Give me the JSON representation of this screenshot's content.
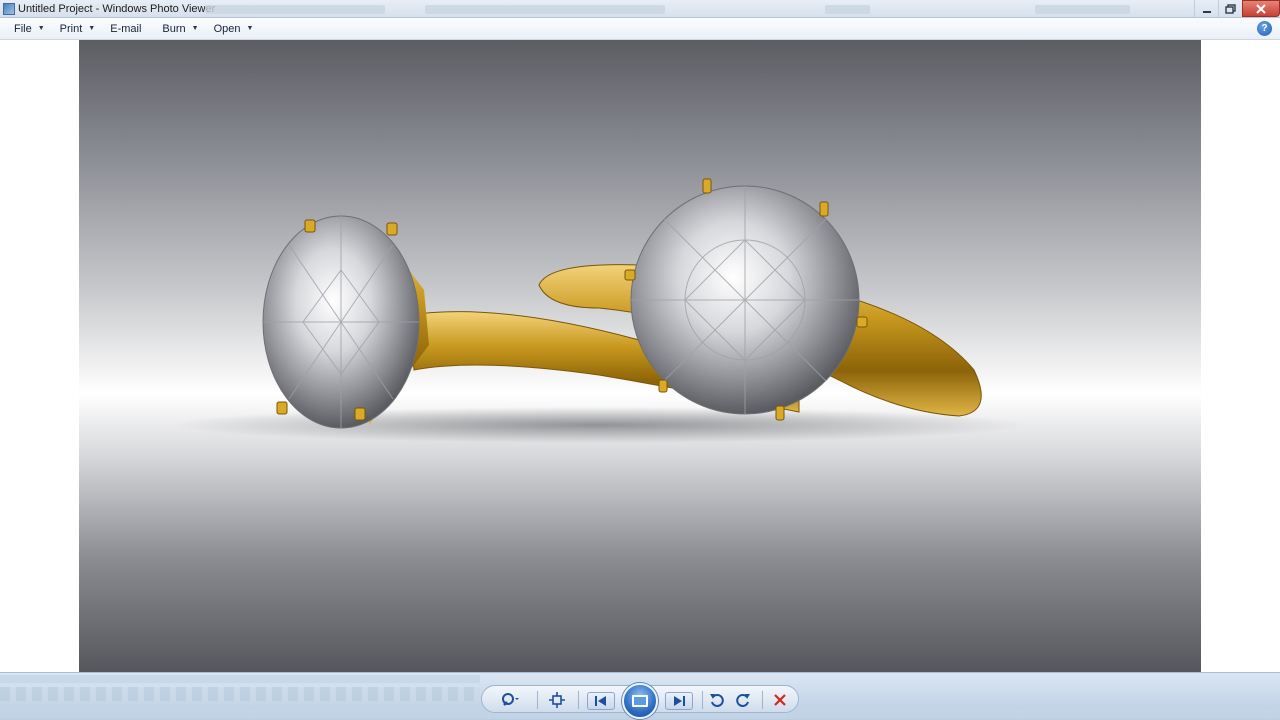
{
  "window": {
    "title": "Untitled Project - Windows Photo Viewer"
  },
  "menu": {
    "items": [
      {
        "label": "File",
        "has_dropdown": true
      },
      {
        "label": "Print",
        "has_dropdown": true
      },
      {
        "label": "E-mail",
        "has_dropdown": false
      },
      {
        "label": "Burn",
        "has_dropdown": true
      },
      {
        "label": "Open",
        "has_dropdown": true
      }
    ]
  },
  "icons": {
    "app": "photo-viewer-icon",
    "help": "help-icon",
    "zoom": "magnifier-icon",
    "actual_size": "actual-size-icon",
    "previous": "previous-icon",
    "slideshow": "slideshow-icon",
    "next": "next-icon",
    "rotate_ccw": "rotate-counterclockwise-icon",
    "rotate_cw": "rotate-clockwise-icon",
    "delete": "delete-icon"
  },
  "colors": {
    "gold": "#c8981e",
    "close_button": "#c84133",
    "slideshow_button": "#2c6cc2",
    "delete": "#d3271b"
  }
}
